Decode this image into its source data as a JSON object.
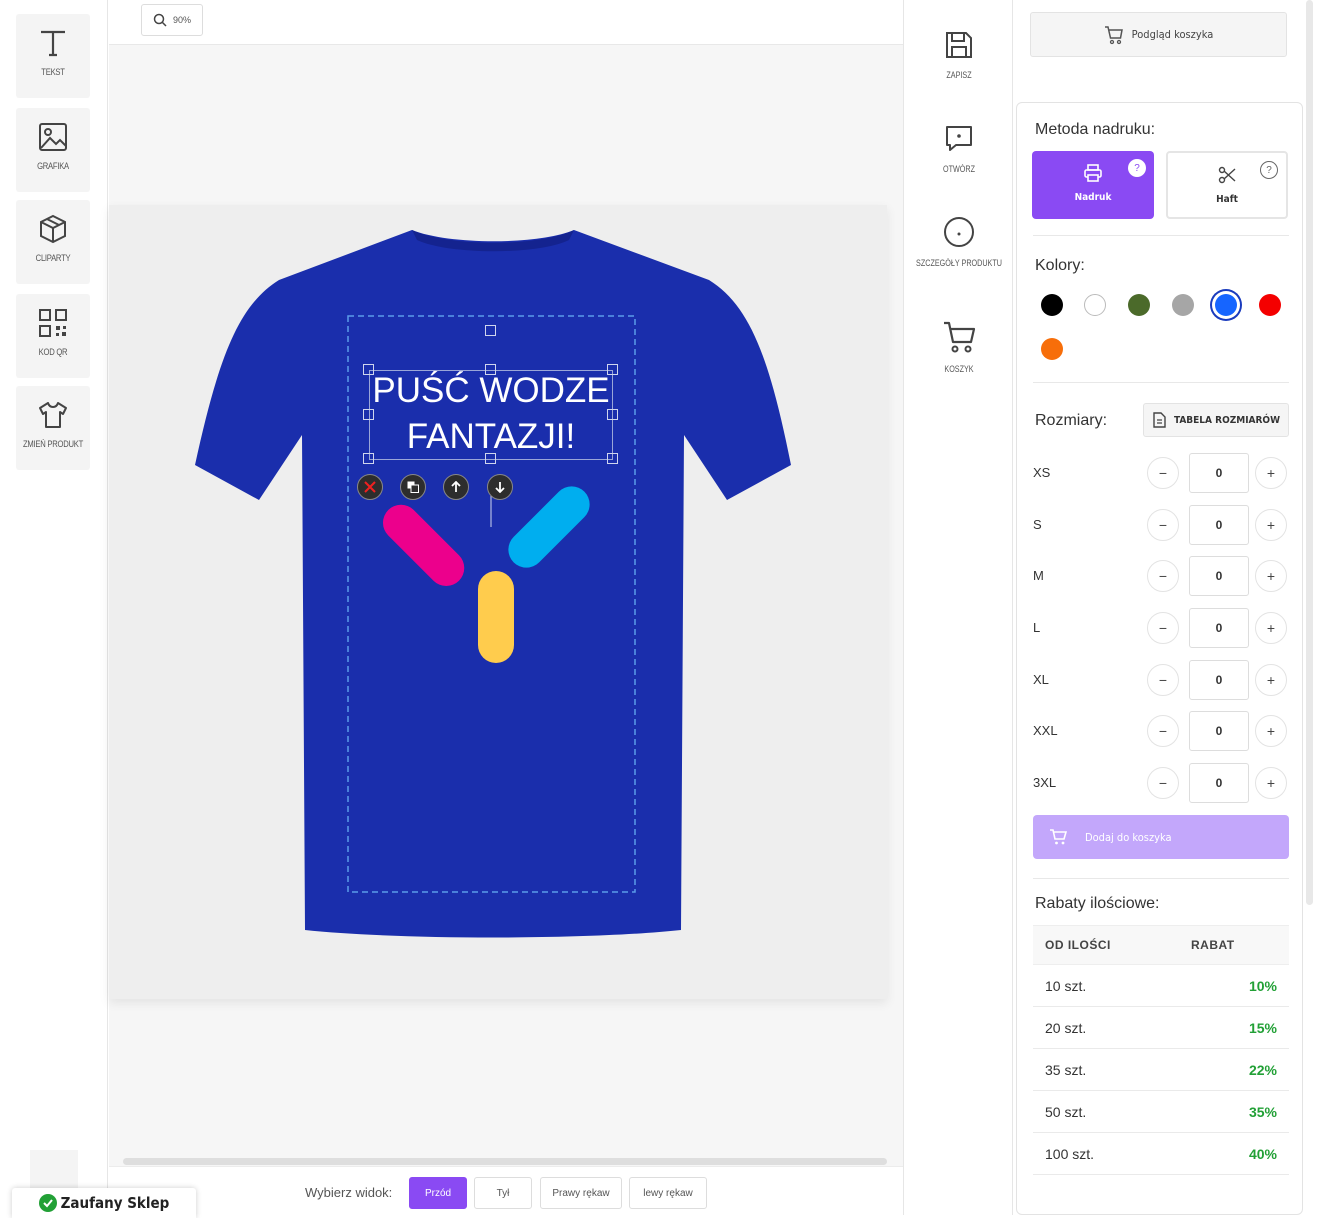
{
  "toolbar": {
    "tools": [
      {
        "label": "TEKST",
        "icon": "text-icon"
      },
      {
        "label": "GRAFIKA",
        "icon": "image-icon"
      },
      {
        "label": "CLIPARTY",
        "icon": "box-icon"
      },
      {
        "label": "KOD QR",
        "icon": "qr-code-icon"
      },
      {
        "label": "ZMIEŃ PRODUKT",
        "icon": "tshirt-icon"
      }
    ]
  },
  "zoom": {
    "value": "90%"
  },
  "design": {
    "text_line1": "PUŚĆ WODZE",
    "text_line2": "FANTAZJI!",
    "product_color": "#1a2eac"
  },
  "view": {
    "label": "Wybierz widok:",
    "options": [
      "Przód",
      "Tył",
      "Prawy rękaw",
      "lewy rękaw"
    ],
    "selected": "Przód"
  },
  "trust_badge": "Zaufany Sklep",
  "actions": [
    {
      "label": "ZAPISZ",
      "icon": "save-icon"
    },
    {
      "label": "OTWÓRZ",
      "icon": "open-icon"
    },
    {
      "label": "SZCZEGÓŁY PRODUKTU",
      "icon": "info-icon"
    },
    {
      "label": "KOSZYK",
      "icon": "cart-icon"
    }
  ],
  "panel": {
    "cart_preview": "Podgląd koszyka",
    "print_method_title": "Metoda nadruku:",
    "methods": [
      {
        "label": "Nadruk",
        "active": true
      },
      {
        "label": "Haft",
        "active": false
      }
    ],
    "colors_title": "Kolory:",
    "colors": [
      "#000000",
      "#ffffff",
      "#4b6a2a",
      "#a6a6a6",
      "#1665ff",
      "#f40000",
      "#f76e0a"
    ],
    "selected_color": "#1665ff",
    "sizes_title": "Rozmiary:",
    "size_table": "TABELA ROZMIARÓW",
    "sizes": [
      {
        "label": "XS",
        "qty": "0"
      },
      {
        "label": "S",
        "qty": "0"
      },
      {
        "label": "M",
        "qty": "0"
      },
      {
        "label": "L",
        "qty": "0"
      },
      {
        "label": "XL",
        "qty": "0"
      },
      {
        "label": "XXL",
        "qty": "0"
      },
      {
        "label": "3XL",
        "qty": "0"
      }
    ],
    "add_to_cart": "Dodaj do koszyka",
    "discounts_title": "Rabaty ilościowe:",
    "discount_headers": [
      "OD ILOŚCI",
      "RABAT"
    ],
    "discounts": [
      {
        "qty": "10 szt.",
        "rate": "10%"
      },
      {
        "qty": "20 szt.",
        "rate": "15%"
      },
      {
        "qty": "35 szt.",
        "rate": "22%"
      },
      {
        "qty": "50 szt.",
        "rate": "35%"
      },
      {
        "qty": "100 szt.",
        "rate": "40%"
      }
    ]
  }
}
